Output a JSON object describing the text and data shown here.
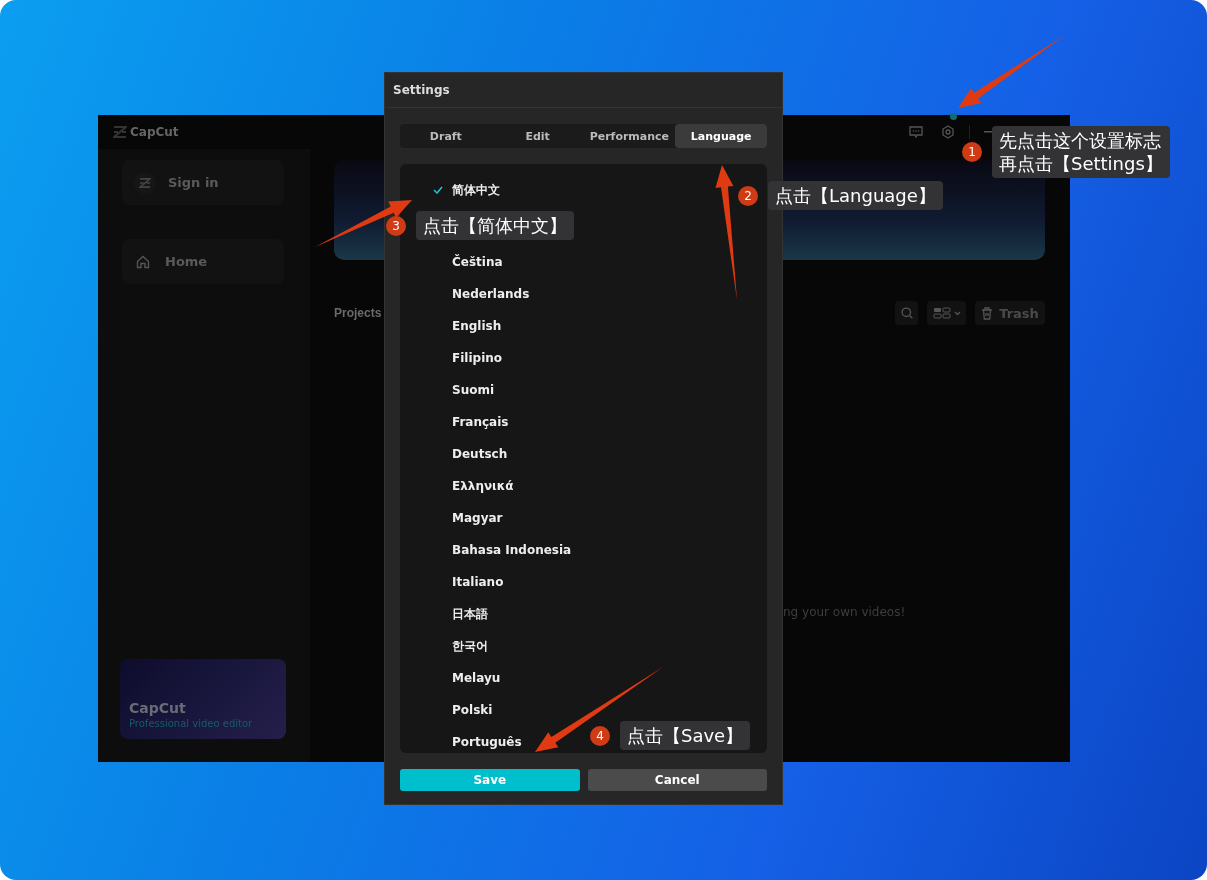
{
  "app_window": {
    "logo_text": "CapCut",
    "sign_in": "Sign in",
    "nav": [
      {
        "label": "Home"
      }
    ],
    "promo_card": {
      "title": "CapCut",
      "subtitle": "Professional video editor"
    },
    "notification_dot": true,
    "section_title": "Projects",
    "trash_label": "Trash",
    "empty_text": "ng your own videos!"
  },
  "settings_dialog": {
    "title": "Settings",
    "tabs": [
      {
        "label": "Draft",
        "selected": false
      },
      {
        "label": "Edit",
        "selected": false
      },
      {
        "label": "Performance",
        "selected": false
      },
      {
        "label": "Language",
        "selected": true
      }
    ],
    "languages": [
      {
        "label": "简体中文",
        "selected": true
      },
      {
        "label": "Čeština",
        "selected": false
      },
      {
        "label": "Nederlands",
        "selected": false
      },
      {
        "label": "English",
        "selected": false
      },
      {
        "label": "Filipino",
        "selected": false
      },
      {
        "label": "Suomi",
        "selected": false
      },
      {
        "label": "Français",
        "selected": false
      },
      {
        "label": "Deutsch",
        "selected": false
      },
      {
        "label": "Ελληνικά",
        "selected": false
      },
      {
        "label": "Magyar",
        "selected": false
      },
      {
        "label": "Bahasa Indonesia",
        "selected": false
      },
      {
        "label": "Italiano",
        "selected": false
      },
      {
        "label": "日本語",
        "selected": false
      },
      {
        "label": "한국어",
        "selected": false
      },
      {
        "label": "Melayu",
        "selected": false
      },
      {
        "label": "Polski",
        "selected": false
      },
      {
        "label": "Português",
        "selected": false
      }
    ],
    "save": "Save",
    "cancel": "Cancel"
  },
  "annotations": [
    {
      "number": "1",
      "lines": [
        "先点击这个设置标志",
        "再点击【Settings】"
      ]
    },
    {
      "number": "2",
      "lines": [
        "点击【Language】"
      ]
    },
    {
      "number": "3",
      "lines": [
        "点击【简体中文】"
      ]
    },
    {
      "number": "4",
      "lines": [
        "点击【Save】"
      ]
    }
  ]
}
